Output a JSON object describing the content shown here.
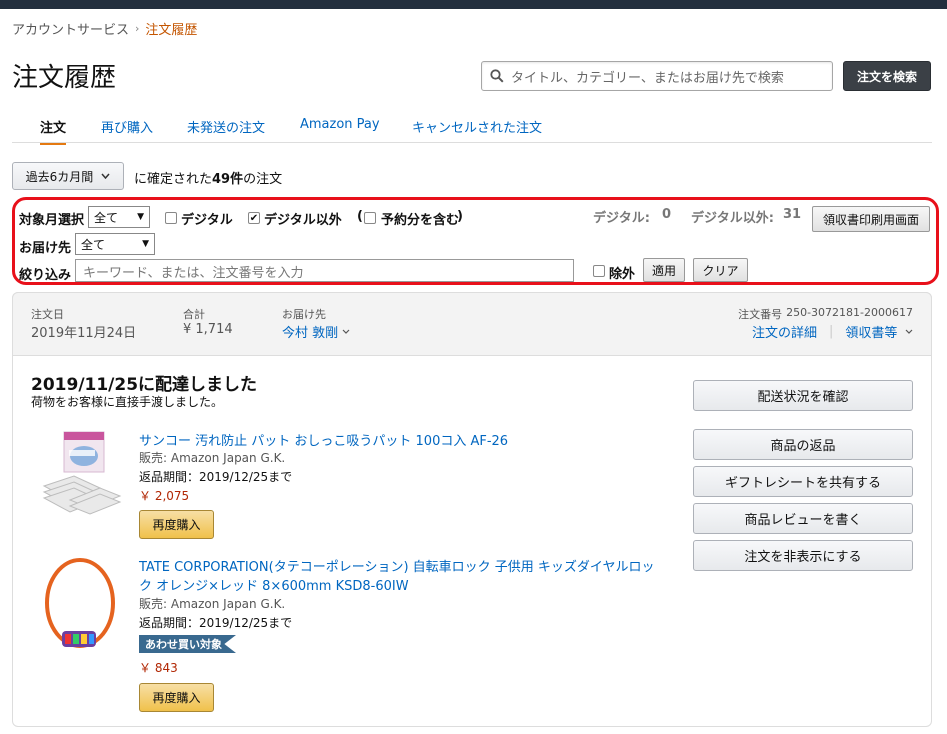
{
  "breadcrumb": {
    "parent": "アカウントサービス",
    "separator": "›",
    "current": "注文履歴"
  },
  "page": {
    "title": "注文履歴"
  },
  "search": {
    "placeholder": "タイトル、カテゴリー、またはお届け先で検索",
    "button": "注文を検索"
  },
  "tabs": [
    {
      "label": "注文",
      "active": true
    },
    {
      "label": "再び購入"
    },
    {
      "label": "未発送の注文"
    },
    {
      "label": "Amazon Pay"
    },
    {
      "label": "キャンセルされた注文"
    }
  ],
  "period": {
    "selected": "過去6カ月間",
    "prefix": "に確定された",
    "count": "49件",
    "suffix": "の注文"
  },
  "filters": {
    "month_label": "対象月選択",
    "month_value": "全て",
    "digital_label": "デジタル",
    "digital_checked": false,
    "non_digital_label": "デジタル以外",
    "non_digital_checked": true,
    "reserve_label": "予約分を含む",
    "reserve_open": "(",
    "reserve_close": ")",
    "digital_count_label": "デジタル:",
    "digital_count": "0",
    "non_digital_count_label": "デジタル以外:",
    "non_digital_count": "31",
    "receipt_button": "領収書印刷用画面",
    "ship_label": "お届け先",
    "ship_value": "全て",
    "narrow_label": "絞り込み",
    "narrow_placeholder": "キーワード、または、注文番号を入力",
    "exclude_label": "除外",
    "apply_button": "適用",
    "clear_button": "クリア"
  },
  "order": {
    "date_label": "注文日",
    "date": "2019年11月24日",
    "total_label": "合計",
    "total": "¥ 1,714",
    "ship_to_label": "お届け先",
    "ship_to": "今村 敦剛",
    "order_no_label": "注文番号",
    "order_no": "250-3072181-2000617",
    "details_link": "注文の詳細",
    "divider": "|",
    "receipt_link": "領収書等",
    "status": "2019/11/25に配達しました",
    "status_sub": "荷物をお客様に直接手渡しました。",
    "actions": [
      "配送状況を確認",
      "商品の返品",
      "ギフトレシートを共有する",
      "商品レビューを書く",
      "注文を非表示にする"
    ],
    "items": [
      {
        "title": "サンコー 汚れ防止 パット おしっこ吸うパット 100コ入 AF-26",
        "seller": "販売: Amazon Japan G.K.",
        "return": "返品期間：2019/12/25まで",
        "price": "￥ 2,075",
        "rebuy": "再度購入"
      },
      {
        "title_line1": "TATE CORPORATION(タテコーポレーション) 自転車ロック 子供用 キッズダイヤルロッ",
        "title_line2": "ク オレンジ×レッド 8×600mm KSD8-60IW",
        "seller": "販売: Amazon Japan G.K.",
        "return": "返品期間：2019/12/25まで",
        "badge": "あわせ買い対象",
        "price": "￥ 843",
        "rebuy": "再度購入"
      }
    ]
  }
}
